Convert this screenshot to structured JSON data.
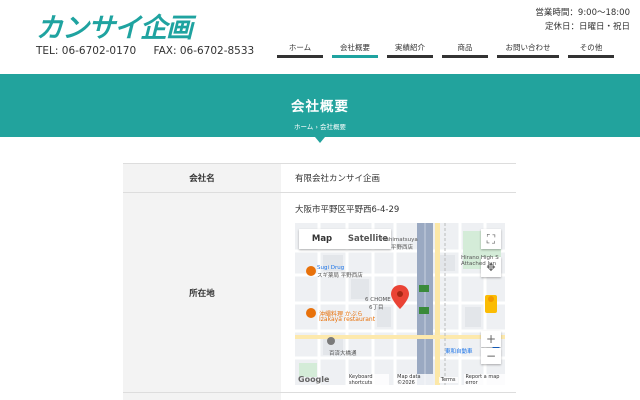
{
  "header": {
    "logo_text": "カンサイ企画",
    "tel": "TEL: 06-6702-0170",
    "fax": "FAX: 06-6702-8533",
    "hours": "営業時間：9:00〜18:00",
    "holidays": "定休日：日曜日・祝日"
  },
  "nav": {
    "home": "ホーム",
    "company": "会社概要",
    "works": "実績紹介",
    "products": "商品",
    "contact": "お問い合わせ",
    "other": "その他",
    "active": "会社概要"
  },
  "banner": {
    "title": "会社概要",
    "breadcrumb_home": "ホーム",
    "breadcrumb_sep": "›",
    "breadcrumb_current": "会社概要"
  },
  "table": {
    "rows": [
      {
        "label": "会社名",
        "value": "有限会社カンサイ企画"
      },
      {
        "label": "所在地",
        "value": "大阪市平野区平野西6-4-29"
      }
    ]
  },
  "map": {
    "map_button": "Map",
    "satellite_button": "Satellite",
    "labels": {
      "station": "Hirano Station",
      "hiranoshi": "hishimatsuya",
      "hiranonishi": "平野西店",
      "sugi": "Sugi Drug",
      "sugi_jp": "スギ薬局 平野西店",
      "hirano_high": "Hirano High S",
      "attached": "Attached Jun",
      "chome": "6 CHOME",
      "chome_jp": "6丁目",
      "okinawa": "沖縄料理 かぶら",
      "izakaya": "Izakaya restaurant",
      "momosu": "百済大橋通",
      "toa": "東和自動車",
      "route": "14"
    },
    "footer": {
      "google": "Google",
      "shortcuts": "Keyboard shortcuts",
      "mapdata": "Map data ©2026",
      "terms": "Terms",
      "report": "Report a map error"
    }
  }
}
